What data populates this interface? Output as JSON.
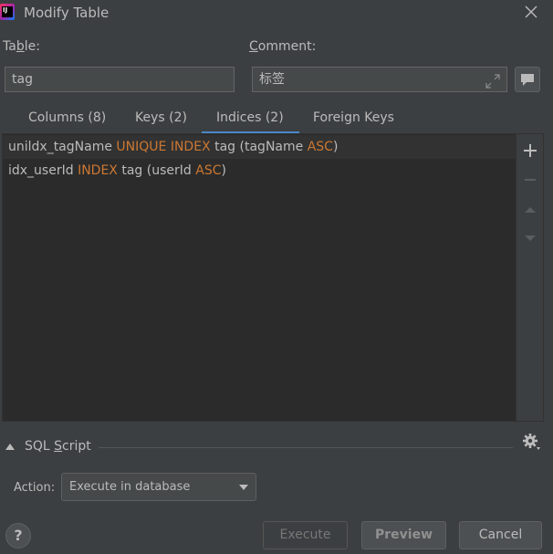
{
  "window": {
    "title": "Modify Table",
    "app_icon_text": "IJ"
  },
  "fields": {
    "table_label": "Table:",
    "table_value": "tag",
    "comment_label": "Comment:",
    "comment_value": "标签"
  },
  "tabs": [
    {
      "label": "Columns (8)",
      "active": false
    },
    {
      "label": "Keys (2)",
      "active": false
    },
    {
      "label": "Indices (2)",
      "active": true
    },
    {
      "label": "Foreign Keys",
      "active": false
    }
  ],
  "indices": [
    {
      "name": "unildx_tagName",
      "type": "UNIQUE INDEX",
      "table": "tag",
      "columns": "(tagName",
      "order": "ASC",
      "close": ")",
      "selected": true
    },
    {
      "name": "idx_userId",
      "type": "INDEX",
      "table": "tag",
      "columns": "(userId",
      "order": "ASC",
      "close": ")",
      "selected": false
    }
  ],
  "sql_script": {
    "label": "SQL Script",
    "expanded": false
  },
  "action": {
    "label": "Action:",
    "selected": "Execute in database"
  },
  "buttons": {
    "help": "?",
    "execute": "Execute",
    "preview": "Preview",
    "cancel": "Cancel"
  },
  "colors": {
    "background": "#3c3f41",
    "list_background": "#2b2b2b",
    "keyword": "#cc7832",
    "tab_underline": "#4a88c7",
    "text": "#bbbbbb"
  }
}
